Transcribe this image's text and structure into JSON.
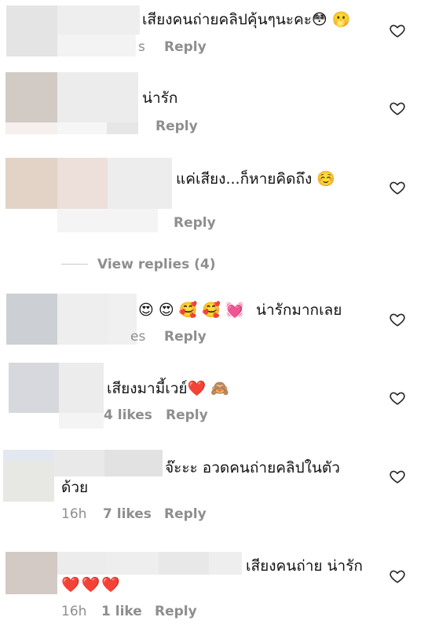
{
  "comments": [
    {
      "text": "เสียงคนถ่ายคลิปคุ้นๆนะคะ😳 🫢",
      "meta_partial": "s",
      "reply": "Reply"
    },
    {
      "text": "น่ารัก",
      "reply": "Reply"
    },
    {
      "text": "แค่เสียง...ก็หายคิดถึง ☺️",
      "reply": "Reply",
      "view_replies": "View replies (4)"
    },
    {
      "emojis": "😍 😍 🥰 🥰 💓",
      "text": "น่ารักมากเลย",
      "meta_partial": "es",
      "reply": "Reply"
    },
    {
      "text": "เสียงมามี้เวย์❤️ 🙈",
      "meta_partial": "4 likes",
      "reply": "Reply"
    },
    {
      "text_line1": "จ๊ะะะ อวดคนถ่ายคลิปในตัว",
      "text_line2": "ด้วย",
      "time": "16h",
      "likes": "7 likes",
      "reply": "Reply"
    },
    {
      "text": "เสียงคนถ่าย น่ารัก",
      "emojis": "❤️❤️❤️",
      "time": "16h",
      "likes": "1 like",
      "reply": "Reply"
    }
  ],
  "icons": {
    "like": "heart-outline-icon"
  },
  "colors": {
    "meta": "#8e8e8e",
    "text": "#111111",
    "divider": "#c8c8c8"
  }
}
